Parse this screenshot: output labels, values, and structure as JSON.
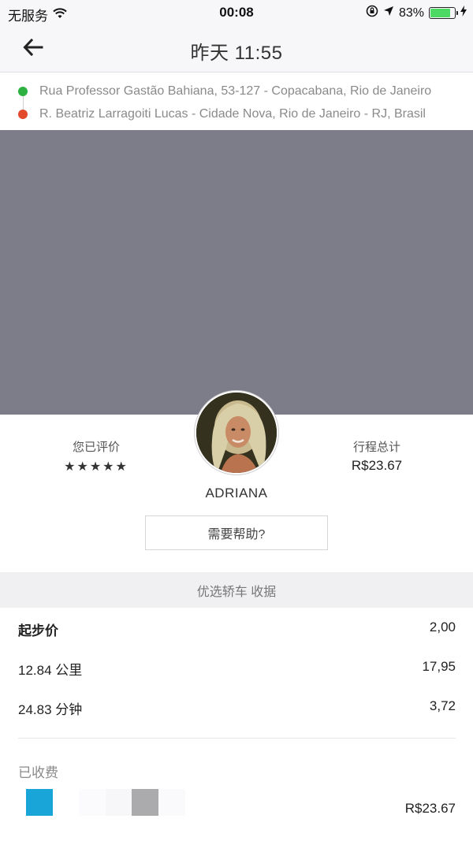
{
  "status_bar": {
    "carrier": "无服务",
    "time": "00:08",
    "battery_percent": "83%",
    "battery_level": 0.83,
    "icons": [
      "wifi-icon",
      "orientation-lock-icon",
      "location-arrow-icon",
      "battery-icon",
      "charging-bolt-icon"
    ]
  },
  "header": {
    "title": "昨天 11:55",
    "back_icon": "arrow-left-icon"
  },
  "route": {
    "pickup": "Rua Professor Gastão Bahiana, 53-127 - Copacabana, Rio de Janeiro",
    "dropoff": "R. Beatriz Larragoiti Lucas - Cidade Nova, Rio de Janeiro - RJ, Brasil",
    "pickup_color": "#2db140",
    "dropoff_color": "#e2492d"
  },
  "map": {
    "color": "#7d7c89"
  },
  "driver": {
    "rated_label": "您已评价",
    "stars": "★★★★★",
    "rating": 5,
    "total_label": "行程总计",
    "total_value": "R$23.67",
    "name": "ADRIANA",
    "help_button": "需要帮助?"
  },
  "receipt": {
    "title": "优选轿车 收据",
    "items": [
      {
        "label": "起步价",
        "value": "2,00",
        "bold": true
      },
      {
        "label": "12.84 公里",
        "value": "17,95",
        "bold": false
      },
      {
        "label": "24.83 分钟",
        "value": "3,72",
        "bold": false
      }
    ],
    "charged_label": "已收费",
    "charged_amount": "R$23.67",
    "card_colors": [
      "#1aa5d8",
      "#fbfbfd",
      "#f7f6f9",
      "#ababad",
      "#fafafc"
    ]
  }
}
